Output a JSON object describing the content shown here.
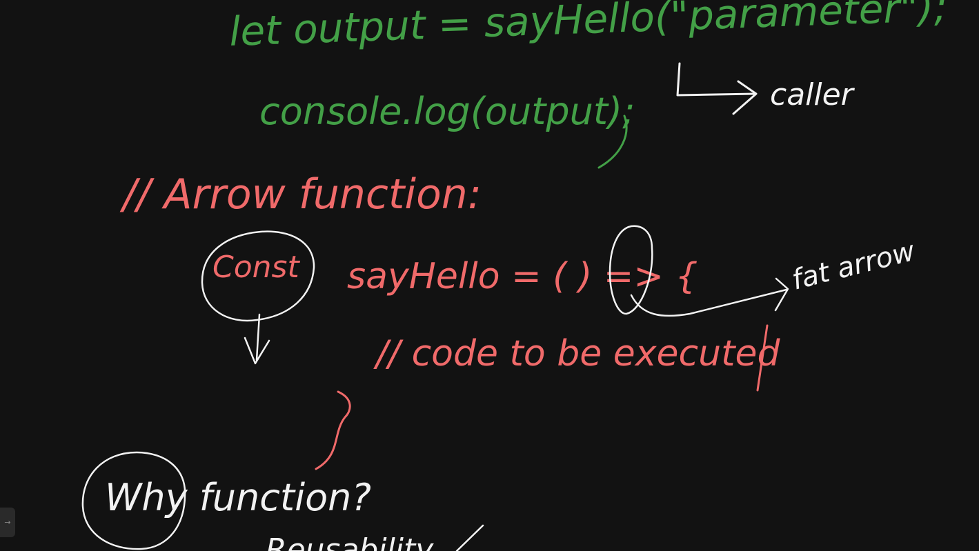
{
  "colors": {
    "background": "#121212",
    "green_ink": "#43a047",
    "red_ink": "#f06a6a",
    "white_ink": "#f2f2f2"
  },
  "notes": {
    "line1": "let output = sayHello(\"parameter\");",
    "line2": "console.log(output);",
    "caller_label": "caller",
    "arrow_heading": "// Arrow function:",
    "const_label": "Const",
    "arrow_decl": "sayHello = ( ) => {",
    "fat_arrow_label": "fat arrow",
    "code_comment": "// code to be executed",
    "why_function": "Why function?",
    "bottom_partial": "Reusability"
  },
  "sidebar": {
    "toggle_icon": "chevron-right-icon",
    "toggle_glyph": "→"
  }
}
